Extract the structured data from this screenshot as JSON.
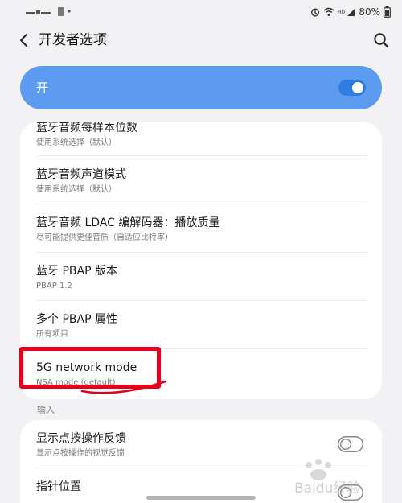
{
  "status_bar": {
    "battery": "80%"
  },
  "header": {
    "title": "开发者选项"
  },
  "master": {
    "label": "开"
  },
  "settings": [
    {
      "title": "蓝牙音频每样本位数",
      "subtitle": "使用系统选择（默认）"
    },
    {
      "title": "蓝牙音频声道模式",
      "subtitle": "使用系统选择（默认）"
    },
    {
      "title": "蓝牙音频 LDAC 编解码器：播放质量",
      "subtitle": "尽可能提供更佳音质（自适应比特率）"
    },
    {
      "title": "蓝牙 PBAP 版本",
      "subtitle": "PBAP 1.2"
    },
    {
      "title": "多个 PBAP 属性",
      "subtitle": "所有项目"
    },
    {
      "title": "5G network mode",
      "subtitle": "NSA mode (default)"
    }
  ],
  "input_section": {
    "label": "输入",
    "items": [
      {
        "title": "显示点按操作反馈",
        "subtitle": "显示点按操作的视觉反馈",
        "enabled": false
      },
      {
        "title": "指针位置",
        "enabled": false
      }
    ]
  },
  "watermark": {
    "text": "Baidu经验"
  },
  "colors": {
    "accent": "#5d9bf0",
    "highlight": "#e5001b"
  }
}
